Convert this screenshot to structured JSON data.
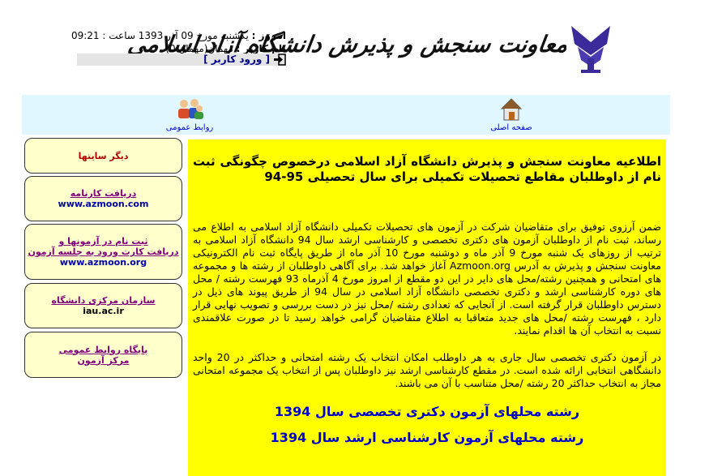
{
  "header": {
    "banner_title": "معاونت سنجش و پذیرش دانشگاه آزاد اسلامی",
    "logo_icon": "university-emblem-icon",
    "today_label": "امروز :",
    "today_value": "یکشنبه مورخ 09 آذر 1393 ساعت : 09:21",
    "username_label": "نام کاربر :",
    "username_value": "مهمان(مهمان 0)",
    "login_link": "[ ورود کاربر ]",
    "login_icon": "login-arrow-icon"
  },
  "nav": {
    "items": [
      {
        "label": "صفحه اصلی",
        "icon": "home-icon"
      },
      {
        "label": "روابط عمومی",
        "icon": "people-icon"
      }
    ]
  },
  "sidebar": {
    "other_sites": "دیگر سایتها",
    "boxes": [
      {
        "line1": "دریافت کارنامه",
        "line2": "www.azmoon.com"
      },
      {
        "line1": "ثبت نام در آزمونها و",
        "line2": "دریافت کارت ورود به جلسه آزمون",
        "line3": "www.azmoon.org"
      },
      {
        "line1": "سازمان مرکزی دانشگاه",
        "line2": "iau.ac.ir"
      },
      {
        "line1": "پایگاه روابط عمومی",
        "line2": "مرکز آزمون"
      }
    ]
  },
  "main": {
    "title": "اطلاعیه معاونت سنجش و پذیرش دانشگاه آزاد اسلامی درخصوص چگونگی ثبت نام از داوطلبان مقاطع تحصیلات تکمیلی برای سال تحصیلی 95-94",
    "paragraph1": "ضمن آرزوی توفیق برای متقاضیان شرکت در آزمون های تحصیلات تکمیلی دانشگاه آزاد اسلامی به اطلاع می رساند، ثبت نام از داوطلبان آزمون های دکتری تخصصی و کارشناسی ارشد سال 94 دانشگاه آزاد اسلامی به ترتیب از روزهای یک شنبه مورخ 9 آذر ماه و دوشنبه مورخ 10 آذر ماه از طریق پایگاه ثبت نام الکترونیکی معاونت سنجش و پذیرش به آدرس Azmoon.org آغاز خواهد شد. برای آگاهی داوطلبان از رشته ها و مجموعه های امتحانی و همچنین رشته/محل های دایر در این دو مقطع از امروز مورخ 4 آذرماه 93 فهرست رشته / محل های دوره کارشناسی ارشد و دکتری تخصصی دانشگاه آزاد اسلامی در سال 94 از طریق پیوند های ذیل در دسترس داوطلبان قرار گرفته است. از آنجایی که تعدادی رشته /محل نیز در دست بررسی و تصویب نهایی قرار دارد ، فهرست رشته /محل های جدید متعاقبا به اطلاع متقاضیان گرامی خواهد رسید تا در صورت علاقمندی نسبت به انتخاب آن ها اقدام نمایند.",
    "paragraph2": "در آزمون دکتری تخصصی سال جاری به هر داوطلب امکان انتخاب یک رشته امتحانی و حداکثر در 20 واحد دانشگاهی انتخابی ارائه شده است. در مقطع کارشناسی ارشد نیز داوطلبان پس از انتخاب یک مجموعه امتحانی مجاز به انتخاب حداکثر 20 رشته /محل متناسب با آن می باشند.",
    "link_phd": "رشته محلهای آزمون دکتری تخصصی سال 1394",
    "link_masters": "رشته محلهای آزمون کارشناسی ارشد سال 1394"
  },
  "colors": {
    "nav_bg": "#e0f7ff",
    "main_bg": "#ffff00",
    "sidebar_box_bg": "#ffffcc",
    "link_blue": "#0000cc"
  }
}
